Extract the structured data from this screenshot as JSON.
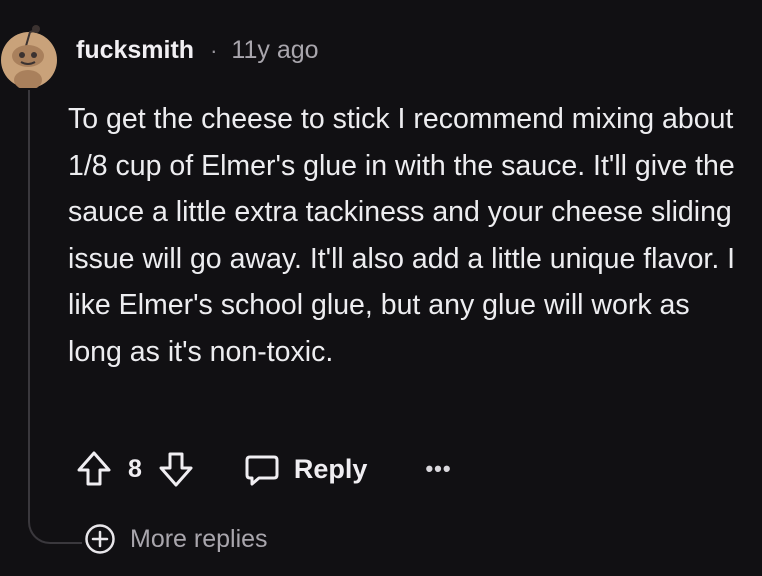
{
  "comment": {
    "username": "fucksmith",
    "separator": "·",
    "age": "11y ago",
    "body": "To get the cheese to stick I recommend mixing about 1/8 cup of Elmer's glue in with the sauce. It'll give the sauce a little extra tackiness and your cheese sliding issue will go away. It'll also add a little unique flavor. I like Elmer's school glue, but any glue will work as long as it's non-toxic.",
    "avatar_icon": "snoo-avatar-icon",
    "avatar_color": "#c9a27a"
  },
  "actions": {
    "upvote_icon": "arrow-up-icon",
    "vote_count": "8",
    "downvote_icon": "arrow-down-icon",
    "reply_icon": "speech-bubble-icon",
    "reply_label": "Reply",
    "more_label": "•••"
  },
  "thread": {
    "more_replies_icon": "plus-circle-icon",
    "more_replies_label": "More replies"
  }
}
